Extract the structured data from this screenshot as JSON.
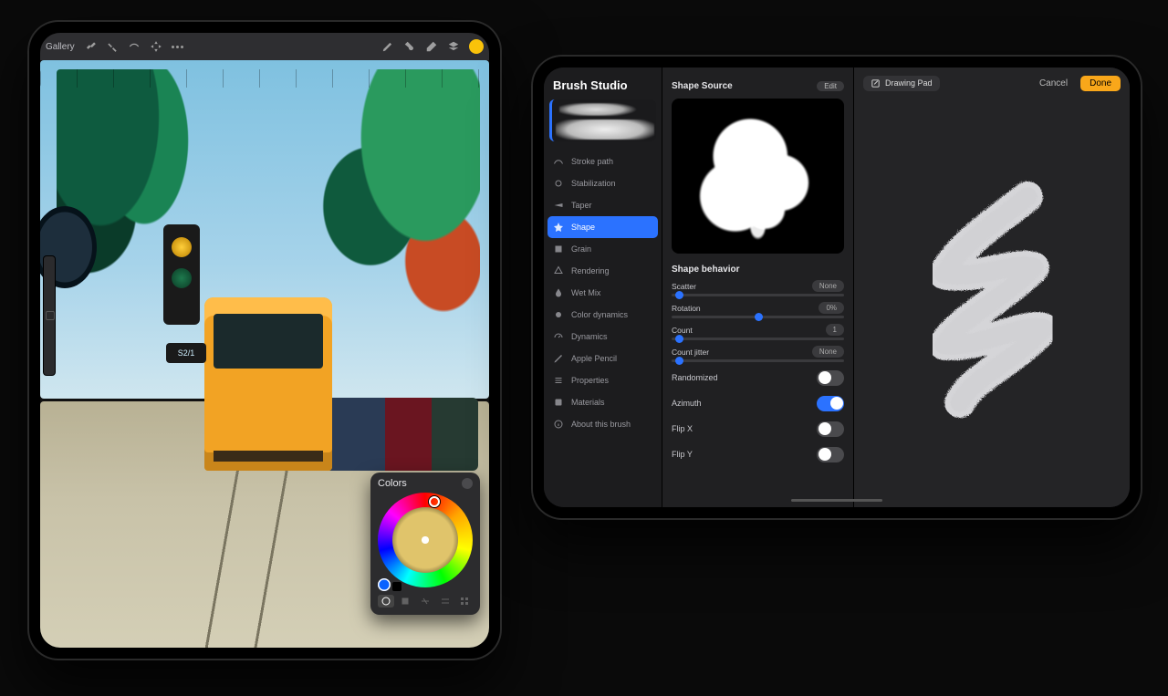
{
  "left_app": {
    "topbar": {
      "gallery": "Gallery"
    },
    "sign_text": "S2/1",
    "colors_panel": {
      "title": "Colors"
    }
  },
  "right_app": {
    "title": "Brush Studio",
    "sidebar": {
      "items": [
        {
          "label": "Stroke path"
        },
        {
          "label": "Stabilization"
        },
        {
          "label": "Taper"
        },
        {
          "label": "Shape"
        },
        {
          "label": "Grain"
        },
        {
          "label": "Rendering"
        },
        {
          "label": "Wet Mix"
        },
        {
          "label": "Color dynamics"
        },
        {
          "label": "Dynamics"
        },
        {
          "label": "Apple Pencil"
        },
        {
          "label": "Properties"
        },
        {
          "label": "Materials"
        },
        {
          "label": "About this brush"
        }
      ],
      "selected_index": 3
    },
    "mid": {
      "section1_title": "Shape Source",
      "edit": "Edit",
      "section2_title": "Shape behavior",
      "sliders": [
        {
          "label": "Scatter",
          "value": "None",
          "pos": 0.02
        },
        {
          "label": "Rotation",
          "value": "0%",
          "pos": 0.5
        },
        {
          "label": "Count",
          "value": "1",
          "pos": 0.02
        },
        {
          "label": "Count jitter",
          "value": "None",
          "pos": 0.02
        }
      ],
      "switches": [
        {
          "label": "Randomized",
          "on": false
        },
        {
          "label": "Azimuth",
          "on": true
        },
        {
          "label": "Flip X",
          "on": false
        },
        {
          "label": "Flip Y",
          "on": false
        }
      ]
    },
    "right": {
      "drawing_pad": "Drawing Pad",
      "cancel": "Cancel",
      "done": "Done"
    }
  },
  "colors": {
    "accent": "#2b72ff",
    "done": "#f9a71a",
    "swatch": "#f9c20a"
  }
}
